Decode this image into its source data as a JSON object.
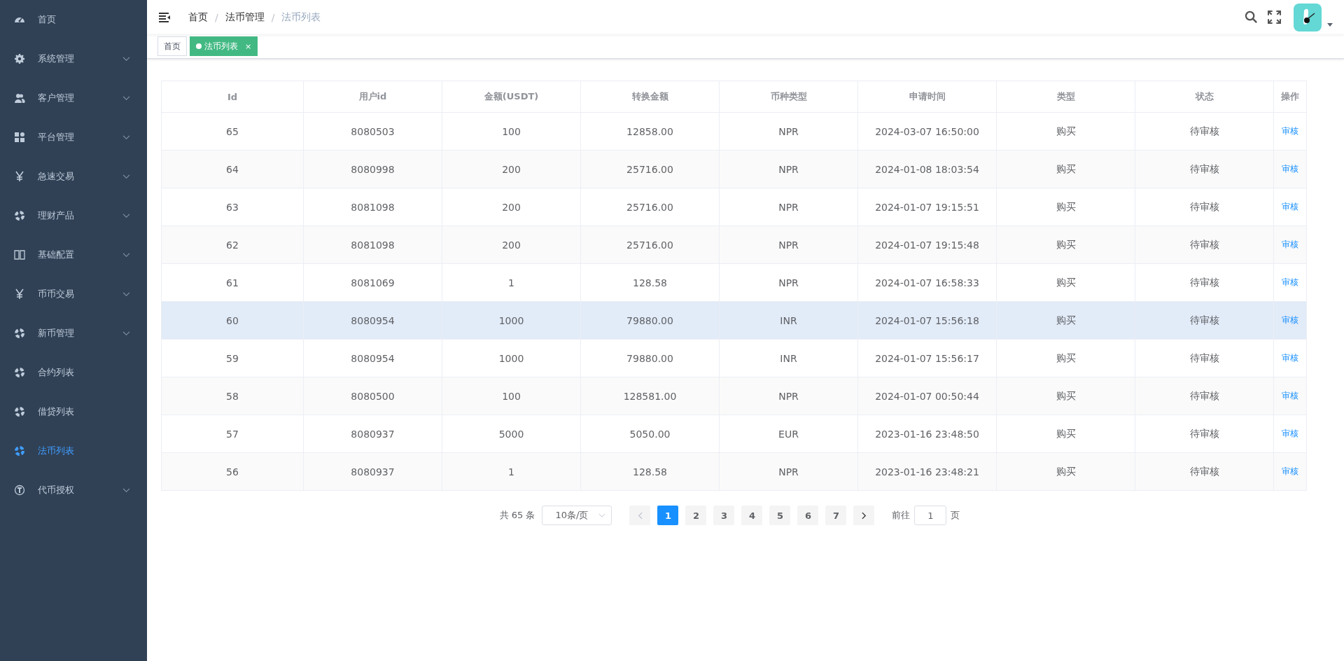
{
  "sidebar": {
    "items": [
      {
        "label": "首页",
        "expandable": false,
        "selected": false
      },
      {
        "label": "系统管理",
        "expandable": true,
        "selected": false
      },
      {
        "label": "客户管理",
        "expandable": true,
        "selected": false
      },
      {
        "label": "平台管理",
        "expandable": true,
        "selected": false
      },
      {
        "label": "急速交易",
        "expandable": true,
        "selected": false
      },
      {
        "label": "理财产品",
        "expandable": true,
        "selected": false
      },
      {
        "label": "基础配置",
        "expandable": true,
        "selected": false
      },
      {
        "label": "币币交易",
        "expandable": true,
        "selected": false
      },
      {
        "label": "新币管理",
        "expandable": true,
        "selected": false
      },
      {
        "label": "合约列表",
        "expandable": false,
        "selected": false
      },
      {
        "label": "借贷列表",
        "expandable": false,
        "selected": false
      },
      {
        "label": "法币列表",
        "expandable": false,
        "selected": true
      },
      {
        "label": "代币授权",
        "expandable": true,
        "selected": false
      }
    ]
  },
  "breadcrumb": {
    "items": [
      "首页",
      "法币管理",
      "法币列表"
    ],
    "separator": "/"
  },
  "tags": [
    {
      "label": "首页",
      "selected": false,
      "closable": false
    },
    {
      "label": "法币列表",
      "selected": true,
      "closable": true,
      "close": "×"
    }
  ],
  "table": {
    "columns": [
      "Id",
      "用户id",
      "金额(USDT)",
      "转换金额",
      "币种类型",
      "申请时间",
      "类型",
      "状态",
      "操作"
    ],
    "rows": [
      {
        "cells": [
          "65",
          "8080503",
          "100",
          "12858.00",
          "NPR",
          "2024-03-07 16:50:00",
          "购买",
          "待审核"
        ],
        "action": "审核",
        "hovered": false
      },
      {
        "cells": [
          "64",
          "8080998",
          "200",
          "25716.00",
          "NPR",
          "2024-01-08 18:03:54",
          "购买",
          "待审核"
        ],
        "action": "审核",
        "hovered": false
      },
      {
        "cells": [
          "63",
          "8081098",
          "200",
          "25716.00",
          "NPR",
          "2024-01-07 19:15:51",
          "购买",
          "待审核"
        ],
        "action": "审核",
        "hovered": false
      },
      {
        "cells": [
          "62",
          "8081098",
          "200",
          "25716.00",
          "NPR",
          "2024-01-07 19:15:48",
          "购买",
          "待审核"
        ],
        "action": "审核",
        "hovered": false
      },
      {
        "cells": [
          "61",
          "8081069",
          "1",
          "128.58",
          "NPR",
          "2024-01-07 16:58:33",
          "购买",
          "待审核"
        ],
        "action": "审核",
        "hovered": false
      },
      {
        "cells": [
          "60",
          "8080954",
          "1000",
          "79880.00",
          "INR",
          "2024-01-07 15:56:18",
          "购买",
          "待审核"
        ],
        "action": "审核",
        "hovered": true
      },
      {
        "cells": [
          "59",
          "8080954",
          "1000",
          "79880.00",
          "INR",
          "2024-01-07 15:56:17",
          "购买",
          "待审核"
        ],
        "action": "审核",
        "hovered": false
      },
      {
        "cells": [
          "58",
          "8080500",
          "100",
          "128581.00",
          "NPR",
          "2024-01-07 00:50:44",
          "购买",
          "待审核"
        ],
        "action": "审核",
        "hovered": false
      },
      {
        "cells": [
          "57",
          "8080937",
          "5000",
          "5050.00",
          "EUR",
          "2023-01-16 23:48:50",
          "购买",
          "待审核"
        ],
        "action": "审核",
        "hovered": false
      },
      {
        "cells": [
          "56",
          "8080937",
          "1",
          "128.58",
          "NPR",
          "2023-01-16 23:48:21",
          "购买",
          "待审核"
        ],
        "action": "审核",
        "hovered": false
      }
    ]
  },
  "pagination": {
    "total": "共 65 条",
    "page_size": "10条/页",
    "pages": [
      {
        "label": "1",
        "selected": true
      },
      {
        "label": "2",
        "selected": false
      },
      {
        "label": "3",
        "selected": false
      },
      {
        "label": "4",
        "selected": false
      },
      {
        "label": "5",
        "selected": false
      },
      {
        "label": "6",
        "selected": false
      },
      {
        "label": "7",
        "selected": false
      }
    ],
    "goto_label": "前往",
    "goto_value": "1",
    "goto_suffix": "页"
  }
}
